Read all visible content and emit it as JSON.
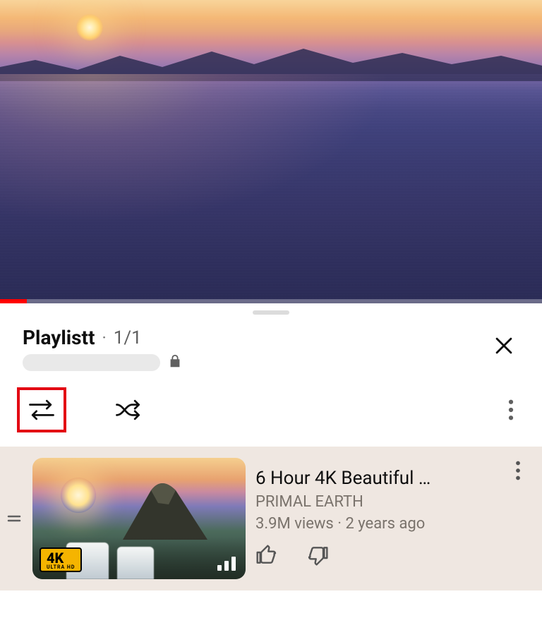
{
  "video": {
    "progress_percent": 5
  },
  "playlist": {
    "title": "Playlistt",
    "position": "1/1",
    "privacy": "private"
  },
  "controls": {
    "loop_highlighted": true
  },
  "items": [
    {
      "title": "6 Hour 4K Beautiful …",
      "channel": "PRIMAL EARTH",
      "views": "3.9M views",
      "age": "2 years ago",
      "badge": "4K",
      "badge_sub": "ULTRA HD",
      "now_playing": true
    }
  ]
}
